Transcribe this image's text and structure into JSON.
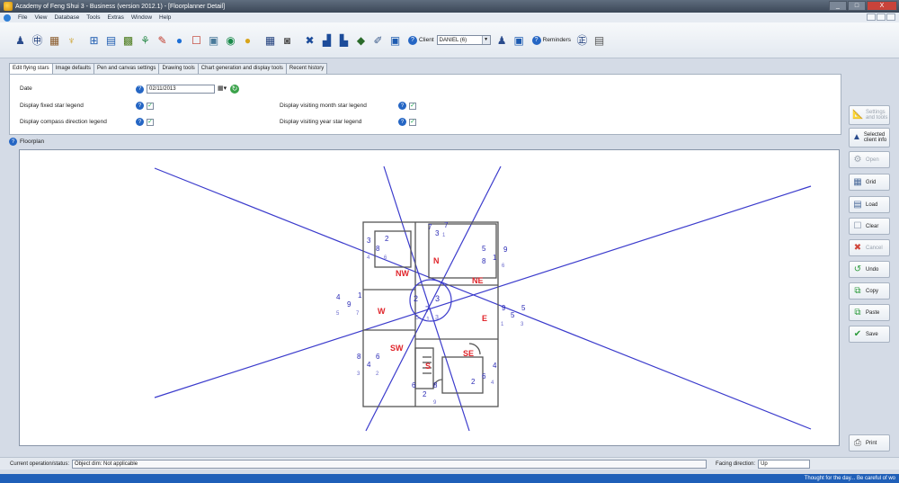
{
  "window": {
    "title": "Academy of Feng Shui 3 - Business (version 2012.1) - [Floorplanner Detail]",
    "controls": [
      "_",
      "□",
      "X"
    ]
  },
  "menu": {
    "items": [
      "File",
      "View",
      "Database",
      "Tools",
      "Extras",
      "Window",
      "Help"
    ]
  },
  "toolbar": {
    "client_label": "Client",
    "client_value": "DANIEL (6)",
    "reminders_label": "Reminders"
  },
  "tabs": [
    {
      "label": "Edit flying stars",
      "active": true
    },
    {
      "label": "Image defaults",
      "active": false
    },
    {
      "label": "Pen and canvas settings",
      "active": false
    },
    {
      "label": "Drawing tools",
      "active": false
    },
    {
      "label": "Chart generation and display tools",
      "active": false
    },
    {
      "label": "Recent history",
      "active": false
    }
  ],
  "settings": {
    "date_label": "Date",
    "date_value": "02/11/2013",
    "fixed_star_legend_label": "Display fixed star legend",
    "compass_legend_label": "Display compass direction legend",
    "month_star_legend_label": "Display visiting month star legend",
    "year_star_legend_label": "Display visiting year star legend",
    "checked": true
  },
  "floorplan": {
    "group_label": "Floorplan",
    "sectors": [
      "N",
      "NE",
      "E",
      "SE",
      "S",
      "SW",
      "W",
      "NW"
    ],
    "center_stars": [
      "2",
      "3",
      "7",
      "5",
      "3",
      "1"
    ],
    "sector_stars": {
      "north": [
        "7",
        "7",
        "3",
        "1"
      ],
      "northeast": [
        "5",
        "9",
        "8",
        "1",
        "6"
      ],
      "east": [
        "9",
        "5",
        "5",
        "1",
        "3"
      ],
      "southeast": [
        "4",
        "2",
        "6",
        "4"
      ],
      "south": [
        "6",
        "8",
        "2",
        "9"
      ],
      "southwest": [
        "8",
        "6",
        "4",
        "3",
        "2"
      ],
      "west": [
        "4",
        "1",
        "9",
        "5",
        "7"
      ],
      "northwest": [
        "3",
        "2",
        "8",
        "4",
        "6"
      ]
    },
    "line_color": "#3b3bcc",
    "sector_label_color": "#e0252b",
    "star_color": "#2a2ab5"
  },
  "side_buttons": {
    "settings": "Settings and tools",
    "selected_client": "Selected client info",
    "open": "Open",
    "grid": "Grid",
    "load": "Load",
    "clear": "Clear",
    "cancel": "Cancel",
    "undo": "Undo",
    "copy": "Copy",
    "paste": "Paste",
    "save": "Save",
    "print": "Print"
  },
  "status": {
    "label": "Current operation/status:",
    "value": "Object dim: Not applicable",
    "facing_label": "Facing direction:",
    "facing_value": "Up"
  },
  "bottom_ticker": "Thought for the day... Be careful of wo"
}
